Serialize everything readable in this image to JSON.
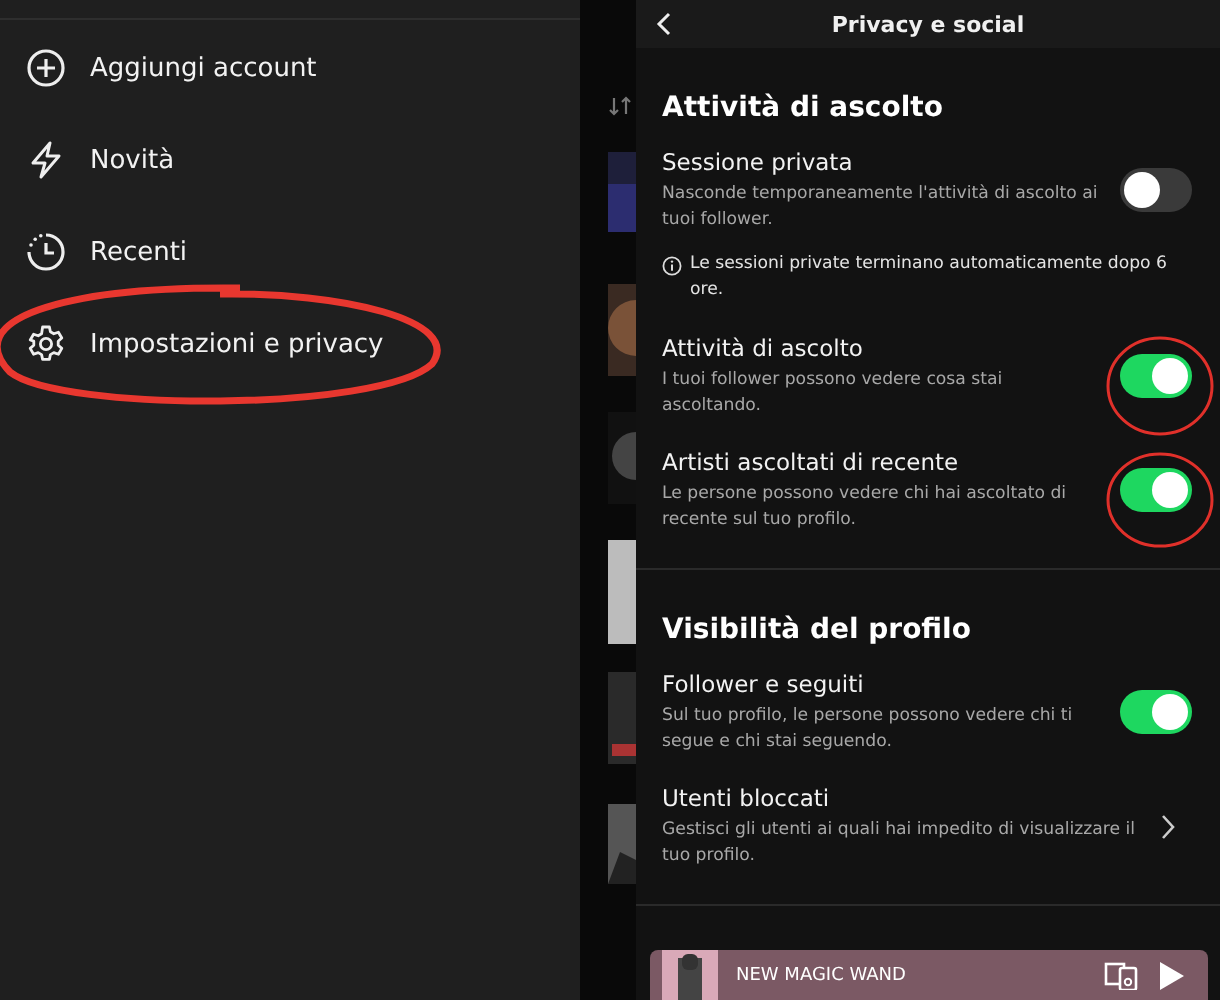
{
  "menu": [
    {
      "kind": "plus",
      "label": "Aggiungi account"
    },
    {
      "kind": "bolt",
      "label": "Novità"
    },
    {
      "kind": "clock",
      "label": "Recenti"
    },
    {
      "kind": "gear",
      "label": "Impostazioni e privacy"
    }
  ],
  "sheet": {
    "title": "Privacy e social",
    "sections": [
      {
        "heading": "Attività di ascolto",
        "items": [
          {
            "kind": "toggle",
            "title": "Sessione privata",
            "description": "Nasconde temporaneamente l'attività di ascolto ai tuoi follower.",
            "on": false
          },
          {
            "kind": "note",
            "text": "Le sessioni private terminano automaticamente dopo 6 ore."
          },
          {
            "kind": "toggle",
            "title": "Attività di ascolto",
            "description": "I tuoi follower possono vedere cosa stai ascoltando.",
            "on": true
          },
          {
            "kind": "toggle",
            "title": "Artisti ascoltati di recente",
            "description": "Le persone possono vedere chi hai ascoltato di recente sul tuo profilo.",
            "on": true
          }
        ]
      },
      {
        "heading": "Visibilità del profilo",
        "items": [
          {
            "kind": "toggle",
            "title": "Follower e seguiti",
            "description": "Sul tuo profilo, le persone possono vedere chi ti segue e chi stai seguendo.",
            "on": true
          },
          {
            "kind": "link",
            "title": "Utenti bloccati",
            "description": "Gestisci gli utenti ai quali hai impedito di visualizzare il tuo profilo."
          }
        ]
      }
    ]
  },
  "player": {
    "title": "NEW MAGIC WAND"
  }
}
